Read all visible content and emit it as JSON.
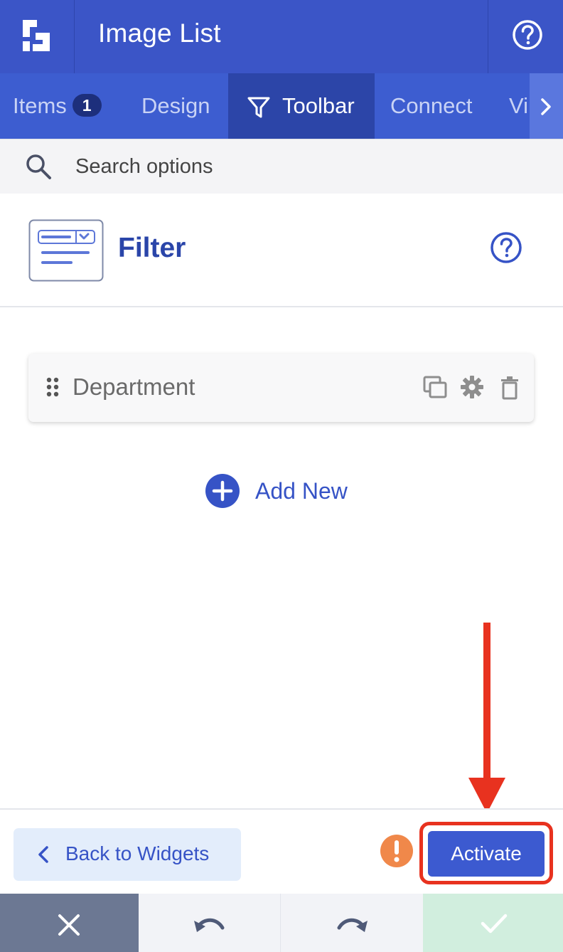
{
  "header": {
    "title": "Image List",
    "logo_icon": "elfsight-logo-icon",
    "help_icon": "help-circle-icon"
  },
  "tabs": [
    {
      "label": "Items",
      "badge": "1"
    },
    {
      "label": "Design"
    },
    {
      "label": "Toolbar",
      "icon": "funnel-icon",
      "active": true
    },
    {
      "label": "Connect"
    },
    {
      "label": "Vi"
    }
  ],
  "search": {
    "placeholder": "Search options",
    "value": ""
  },
  "section": {
    "title": "Filter",
    "thumbnail_icon": "filter-widget-icon"
  },
  "filter_items": [
    {
      "label": "Department",
      "actions": [
        "duplicate-icon",
        "gear-icon",
        "trash-icon"
      ]
    }
  ],
  "add_new": {
    "label": "Add New"
  },
  "footer": {
    "back_label": "Back to Widgets",
    "activate_label": "Activate",
    "warning_icon": "exclamation-icon"
  },
  "bottom_bar": {
    "buttons": [
      "close-icon",
      "undo-icon",
      "redo-icon",
      "check-icon"
    ]
  },
  "colors": {
    "primary": "#3b55c7",
    "active_tab": "#2c45a8",
    "accent_text": "#3653c6",
    "warning": "#f0884a",
    "annotation": "#e8321f",
    "cancel_bg": "#6c7893",
    "confirm_bg": "#d1eede"
  }
}
